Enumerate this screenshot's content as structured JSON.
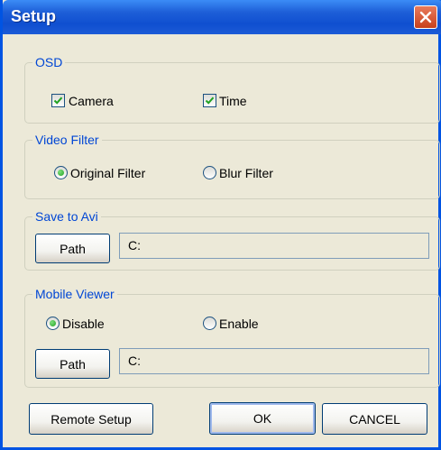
{
  "window": {
    "title": "Setup"
  },
  "osd": {
    "label": "OSD",
    "camera": {
      "label": "Camera",
      "checked": true
    },
    "time": {
      "label": "Time",
      "checked": true
    }
  },
  "video_filter": {
    "label": "Video Filter",
    "options": [
      {
        "label": "Original Filter",
        "selected": true
      },
      {
        "label": "Blur Filter",
        "selected": false
      }
    ]
  },
  "save_to_avi": {
    "label": "Save to Avi",
    "path_button": "Path",
    "path_value": "C:"
  },
  "mobile_viewer": {
    "label": "Mobile Viewer",
    "options": [
      {
        "label": "Disable",
        "selected": true
      },
      {
        "label": "Enable",
        "selected": false
      }
    ],
    "path_button": "Path",
    "path_value": "C:"
  },
  "footer": {
    "remote_setup": "Remote Setup",
    "ok": "OK",
    "cancel": "CANCEL"
  }
}
